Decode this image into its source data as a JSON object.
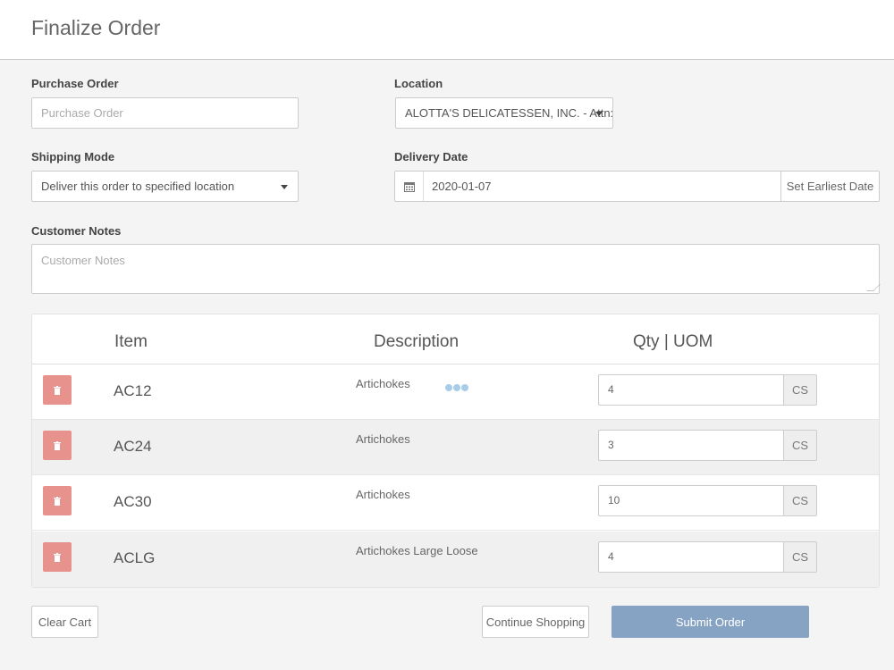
{
  "page": {
    "title": "Finalize Order"
  },
  "form": {
    "purchase_order": {
      "label": "Purchase Order",
      "placeholder": "Purchase Order",
      "value": ""
    },
    "location": {
      "label": "Location",
      "value": "ALOTTA'S DELICATESSEN, INC. - Attn:"
    },
    "shipping_mode": {
      "label": "Shipping Mode",
      "value": "Deliver this order to specified location"
    },
    "delivery_date": {
      "label": "Delivery Date",
      "value": "2020-01-07",
      "button_label": "Set Earliest Date",
      "icon": "calendar-icon"
    },
    "customer_notes": {
      "label": "Customer Notes",
      "placeholder": "Customer Notes",
      "value": ""
    }
  },
  "cart": {
    "columns": {
      "item": "Item",
      "description": "Description",
      "qty_uom": "Qty | UOM"
    },
    "rows": [
      {
        "item": "AC12",
        "description": "Artichokes",
        "qty": "4",
        "uom": "CS",
        "loading": true
      },
      {
        "item": "AC24",
        "description": "Artichokes",
        "qty": "3",
        "uom": "CS",
        "loading": false
      },
      {
        "item": "AC30",
        "description": "Artichokes",
        "qty": "10",
        "uom": "CS",
        "loading": false
      },
      {
        "item": "ACLG",
        "description": "Artichokes Large Loose",
        "qty": "4",
        "uom": "CS",
        "loading": false
      }
    ],
    "delete_icon": "trash-icon"
  },
  "actions": {
    "clear_cart": "Clear Cart",
    "continue_shopping": "Continue Shopping",
    "submit_order": "Submit Order"
  },
  "colors": {
    "delete_button": "#e8928e",
    "submit_button": "#87a3c3",
    "loading_indicator": "#a7cde8",
    "alt_row": "#f0f0f0"
  }
}
